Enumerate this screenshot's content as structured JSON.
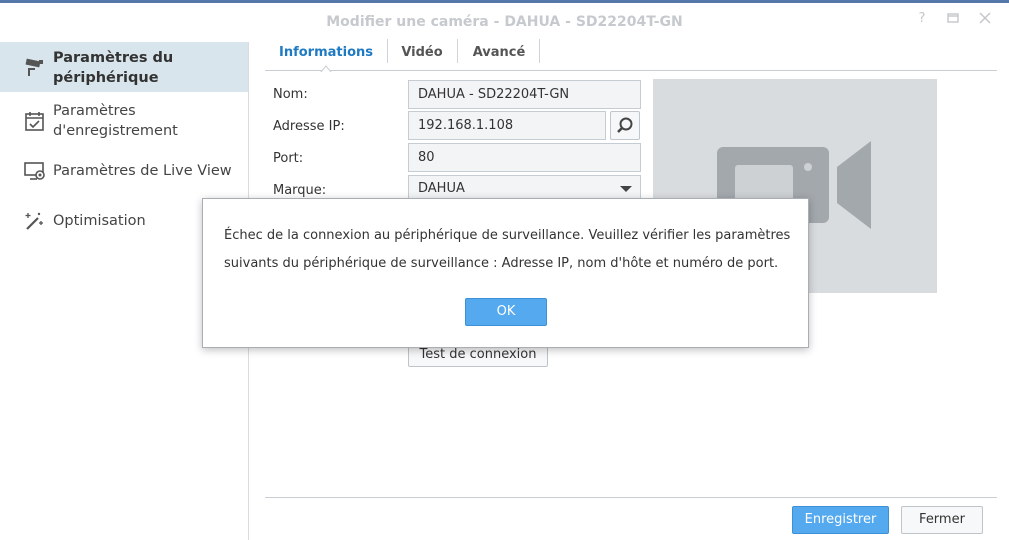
{
  "window": {
    "title": "Modifier une caméra - DAHUA - SD22204T-GN"
  },
  "sidebar": {
    "items": [
      {
        "label": "Paramètres du périphérique",
        "icon": "camera-icon",
        "active": true
      },
      {
        "label": "Paramètres d'enregistrement",
        "icon": "calendar-icon",
        "active": false
      },
      {
        "label": "Paramètres de Live View",
        "icon": "monitor-icon",
        "active": false
      },
      {
        "label": "Optimisation",
        "icon": "magic-wand-icon",
        "active": false
      }
    ]
  },
  "tabs": [
    {
      "label": "Informations",
      "active": true
    },
    {
      "label": "Vidéo",
      "active": false
    },
    {
      "label": "Avancé",
      "active": false
    }
  ],
  "form": {
    "name_label": "Nom:",
    "name_value": "DAHUA - SD22204T-GN",
    "ip_label": "Adresse IP:",
    "ip_value": "192.168.1.108",
    "port_label": "Port:",
    "port_value": "80",
    "brand_label": "Marque:",
    "brand_value": "DAHUA",
    "test_button": "Test de connexion"
  },
  "dialog": {
    "message_line1": "Échec de la connexion au périphérique de surveillance. Veuillez vérifier les paramètres",
    "message_line2": "suivants du périphérique de surveillance : Adresse IP, nom d'hôte et numéro de port.",
    "ok_button": "OK"
  },
  "footer": {
    "save_button": "Enregistrer",
    "close_button": "Fermer"
  },
  "colors": {
    "accent": "#1e7ac2",
    "primary_button": "#54a9ef",
    "sidebar_active": "#d8e5ec"
  }
}
